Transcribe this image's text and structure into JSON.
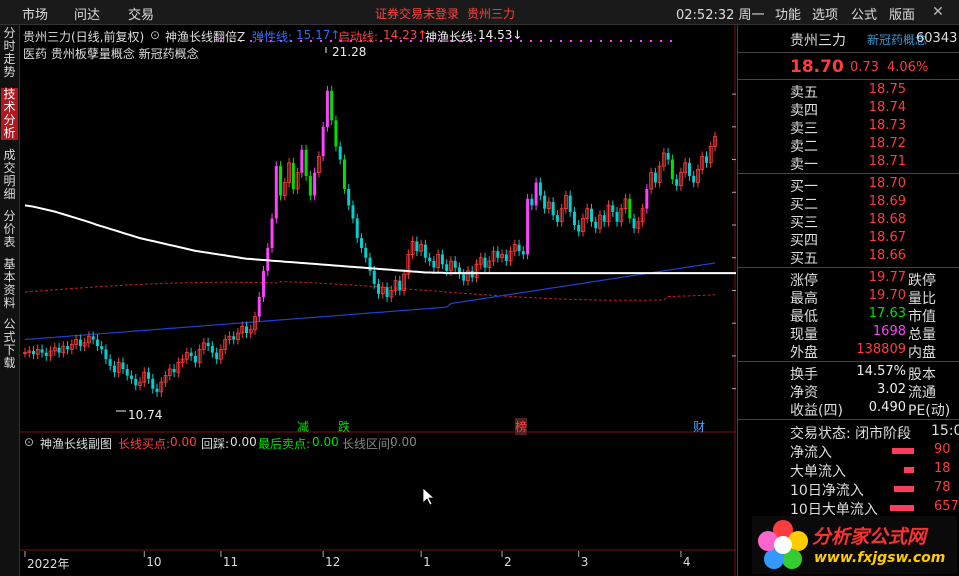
{
  "topbar": {
    "menus": [
      "市场",
      "问达",
      "交易"
    ],
    "notice": "证券交易未登录",
    "stock": "贵州三力",
    "clock": "02:52:32 周一",
    "right_menus": [
      "功能",
      "选项",
      "公式",
      "版面"
    ]
  },
  "sidebar": {
    "tabs": [
      "分时走势",
      "技术分析",
      "成交明细",
      "分价表",
      "基本资料",
      "公式下载"
    ],
    "active": 1
  },
  "chart_header": {
    "title": "贵州三力(日线,前复权)",
    "indicator": "神渔长线翻倍Z",
    "field1_label": "弹性线:",
    "field1_value": "15.17↑",
    "field2_label": "启动线:",
    "field2_value": "14.23↑",
    "field3_label": "神渔长线:",
    "field3_value": "14.53↓",
    "concepts": "医药  贵州板孽量概念 新冠药概念"
  },
  "chart_annotations": {
    "high": "21.28",
    "low": "10.74",
    "tags": [
      "减",
      "跌",
      "榜",
      "财"
    ]
  },
  "sub_header": {
    "name": "神渔长线副图",
    "l1": "长线买点:",
    "v1": "0.00",
    "l2": "回踩:",
    "v2": "0.00",
    "l3": "最后卖点:",
    "v3": "0.00",
    "l4": "长线区间:",
    "v4": "0.00"
  },
  "right_panel": {
    "name": "贵州三力",
    "concept": "新冠药概念",
    "code": "60343",
    "price": "18.70",
    "change": "0.73",
    "pct": "4.06%",
    "sells": [
      {
        "label": "卖五",
        "price": "18.75"
      },
      {
        "label": "卖四",
        "price": "18.74"
      },
      {
        "label": "卖三",
        "price": "18.73"
      },
      {
        "label": "卖二",
        "price": "18.72"
      },
      {
        "label": "卖一",
        "price": "18.71"
      }
    ],
    "buys": [
      {
        "label": "买一",
        "price": "18.70"
      },
      {
        "label": "买二",
        "price": "18.69"
      },
      {
        "label": "买三",
        "price": "18.68"
      },
      {
        "label": "买四",
        "price": "18.67"
      },
      {
        "label": "买五",
        "price": "18.66"
      }
    ],
    "stats": [
      {
        "l": "涨停",
        "v": "19.77",
        "r": "跌停",
        "c": "red"
      },
      {
        "l": "最高",
        "v": "19.70",
        "r": "量比",
        "c": "red"
      },
      {
        "l": "最低",
        "v": "17.63",
        "r": "市值",
        "c": "green"
      },
      {
        "l": "现量",
        "v": "1698",
        "r": "总量",
        "c": "mag"
      },
      {
        "l": "外盘",
        "v": "138809",
        "r": "内盘",
        "c": "red"
      }
    ],
    "stats2": [
      {
        "l": "换手",
        "v": "14.57%",
        "r": "股本"
      },
      {
        "l": "净资",
        "v": "3.02",
        "r": "流通"
      },
      {
        "l": "收益(四)",
        "v": "0.490",
        "r": "PE(动)"
      }
    ],
    "trade_status": "交易状态: 闭市阶段",
    "trade_time": "15:0",
    "flows": [
      {
        "l": "净流入",
        "v": "90"
      },
      {
        "l": "大单流入",
        "v": "18"
      },
      {
        "l": "10日净流入",
        "v": "78"
      },
      {
        "l": "10日大单流入",
        "v": "657"
      }
    ]
  },
  "logo": {
    "text": "分析家公式网",
    "url": "www.fxjgsw.com"
  },
  "chart_data": {
    "type": "candlestick",
    "y_ticks": [
      "20.00",
      "19.00",
      "18.00",
      "17.00",
      "16.00",
      "15.00",
      "14.00",
      "13.00",
      "12.00",
      "11.00"
    ],
    "ylim": [
      10.5,
      21.5
    ],
    "x_ticks": [
      "2022年",
      "10",
      "11",
      "12",
      "1",
      "2",
      "3",
      "4"
    ],
    "x_tick_index": [
      0,
      28,
      46,
      70,
      93,
      112,
      130,
      154
    ],
    "sub_y_ticks": [
      "100.0",
      "80.0",
      "60.0",
      "40.0",
      "20.0"
    ],
    "closes": [
      12.1,
      12.15,
      12.05,
      12.2,
      12.1,
      12.0,
      12.15,
      12.25,
      12.1,
      12.3,
      12.2,
      12.35,
      12.5,
      12.3,
      12.4,
      12.6,
      12.5,
      12.3,
      12.2,
      11.9,
      11.7,
      11.5,
      11.8,
      11.6,
      11.4,
      11.3,
      11.1,
      11.2,
      11.5,
      11.3,
      11.0,
      10.9,
      11.2,
      11.4,
      11.6,
      11.5,
      11.8,
      11.9,
      12.1,
      12.0,
      11.8,
      12.2,
      12.4,
      12.3,
      12.1,
      11.9,
      12.2,
      12.5,
      12.6,
      12.5,
      12.7,
      12.9,
      12.7,
      12.8,
      13.2,
      13.8,
      14.6,
      15.3,
      16.2,
      17.8,
      16.9,
      17.3,
      17.9,
      17.1,
      17.6,
      18.3,
      17.5,
      16.9,
      17.6,
      18.1,
      19.0,
      20.1,
      19.2,
      18.4,
      18.0,
      17.1,
      16.6,
      16.2,
      15.6,
      15.3,
      15.0,
      14.6,
      14.2,
      13.9,
      14.1,
      13.8,
      14.0,
      14.3,
      14.0,
      14.5,
      15.1,
      15.5,
      15.2,
      15.4,
      15.0,
      14.9,
      14.7,
      15.1,
      14.8,
      14.6,
      14.9,
      14.7,
      14.5,
      14.3,
      14.6,
      14.4,
      14.8,
      15.0,
      14.7,
      14.9,
      15.2,
      15.0,
      15.1,
      14.9,
      15.2,
      15.4,
      15.2,
      15.1,
      16.8,
      16.6,
      17.3,
      16.9,
      16.5,
      16.7,
      16.3,
      16.1,
      16.5,
      16.9,
      16.4,
      16.0,
      15.8,
      16.2,
      16.5,
      16.1,
      15.9,
      16.3,
      16.1,
      16.6,
      16.4,
      16.1,
      16.5,
      16.8,
      16.2,
      15.9,
      16.1,
      16.5,
      17.1,
      17.6,
      17.3,
      17.8,
      18.2,
      18.0,
      17.4,
      17.2,
      17.6,
      17.9,
      17.5,
      17.3,
      17.7,
      18.1,
      17.9,
      18.4,
      18.7
    ],
    "long_line": [
      16.6,
      16.58,
      16.56,
      16.53,
      16.5,
      16.47,
      16.44,
      16.41,
      16.37,
      16.33,
      16.29,
      16.25,
      16.21,
      16.17,
      16.13,
      16.09,
      16.05,
      16.0,
      15.96,
      15.92,
      15.88,
      15.84,
      15.8,
      15.76,
      15.72,
      15.68,
      15.64,
      15.6,
      15.57,
      15.54,
      15.51,
      15.48,
      15.45,
      15.42,
      15.39,
      15.36,
      15.33,
      15.3,
      15.27,
      15.24,
      15.21,
      15.19,
      15.17,
      15.15,
      15.13,
      15.11,
      15.09,
      15.07,
      15.05,
      15.03,
      15.01,
      14.99,
      14.97,
      14.96,
      14.95,
      14.94,
      14.93,
      14.92,
      14.91,
      14.9,
      14.89,
      14.88,
      14.87,
      14.86,
      14.85,
      14.84,
      14.83,
      14.82,
      14.81,
      14.8,
      14.79,
      14.78,
      14.77,
      14.76,
      14.75,
      14.74,
      14.73,
      14.72,
      14.71,
      14.7,
      14.69,
      14.68,
      14.67,
      14.66,
      14.65,
      14.64,
      14.63,
      14.62,
      14.61,
      14.6,
      14.59,
      14.58,
      14.57,
      14.56,
      14.55,
      14.55,
      14.54,
      14.54,
      14.54,
      14.53,
      14.53,
      14.53,
      14.53,
      14.53,
      14.53,
      14.53,
      14.53,
      14.53,
      14.53,
      14.53,
      14.53,
      14.53,
      14.53,
      14.53,
      14.53,
      14.53,
      14.53,
      14.53,
      14.53,
      14.53,
      14.53,
      14.53,
      14.53,
      14.53,
      14.53,
      14.53,
      14.53,
      14.53,
      14.53,
      14.53,
      14.53,
      14.53,
      14.53,
      14.53,
      14.53,
      14.53,
      14.53,
      14.53,
      14.53,
      14.53,
      14.53,
      14.53,
      14.53,
      14.53,
      14.53,
      14.53,
      14.53,
      14.53,
      14.53,
      14.53,
      14.53,
      14.53,
      14.53,
      14.53,
      14.53,
      14.53,
      14.53,
      14.53,
      14.53,
      14.53,
      14.53,
      14.53,
      14.53,
      14.53,
      14.53,
      14.53,
      14.53,
      14.53
    ]
  }
}
